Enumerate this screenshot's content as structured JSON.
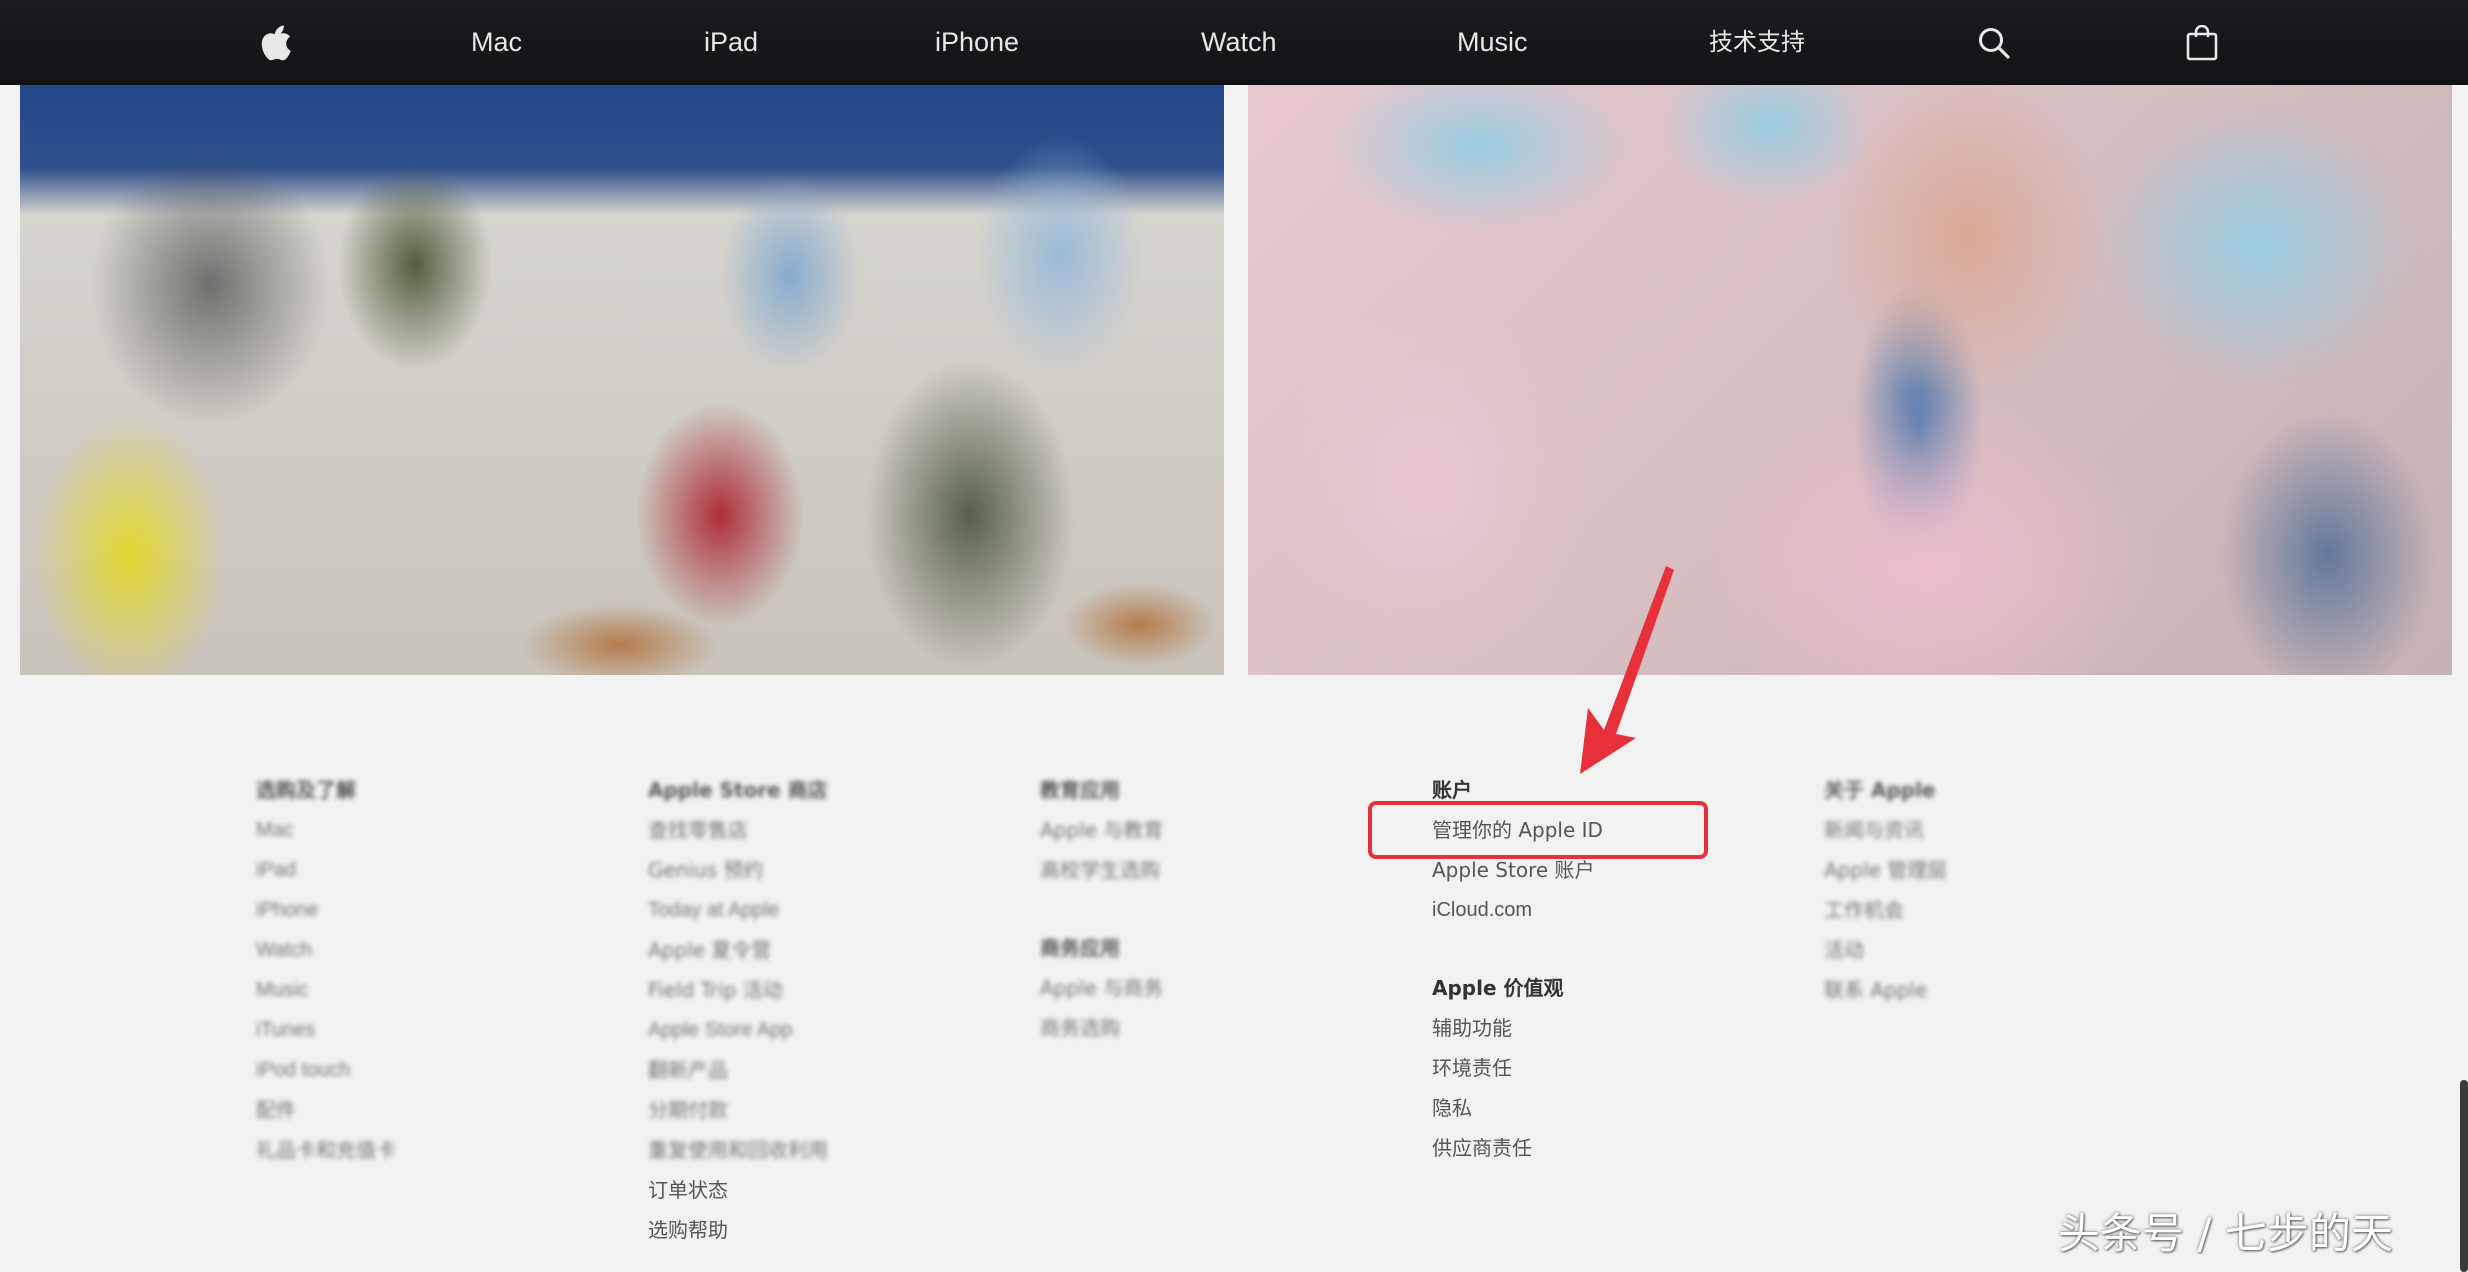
{
  "nav": {
    "items": [
      {
        "label": "Mac"
      },
      {
        "label": "iPad"
      },
      {
        "label": "iPhone"
      },
      {
        "label": "Watch"
      },
      {
        "label": "Music"
      },
      {
        "label": "技术支持"
      }
    ],
    "icons": [
      "apple-logo-icon",
      "search-icon",
      "shopping-bag-icon"
    ],
    "background_color": "#111214"
  },
  "footer": {
    "columns": [
      {
        "heading": "选购及了解",
        "sections": [
          [
            "Mac",
            "iPad",
            "iPhone",
            "Watch",
            "Music",
            "iTunes",
            "iPod touch",
            "配件",
            "礼品卡和充值卡"
          ]
        ]
      },
      {
        "heading": "Apple Store 商店",
        "sections": [
          [
            "查找零售店",
            "Genius 预约",
            "Today at Apple",
            "Apple 夏令营",
            "Field Trip 活动",
            "Apple Store App",
            "翻新产品",
            "分期付款",
            "重复使用和回收利用",
            "订单状态",
            "选购帮助"
          ]
        ]
      },
      {
        "heading": "教育应用",
        "sections": [
          [
            "Apple 与教育",
            "高校学生选购"
          ],
          {
            "heading": "商务应用",
            "links": [
              "Apple 与商务",
              "商务选购"
            ]
          }
        ]
      },
      {
        "heading": "账户",
        "sections": [
          [
            "管理你的 Apple ID",
            "Apple Store 账户",
            "iCloud.com"
          ],
          {
            "heading": "Apple 价值观",
            "links": [
              "辅助功能",
              "环境责任",
              "隐私",
              "供应商责任"
            ]
          }
        ]
      },
      {
        "heading": "关于 Apple",
        "sections": [
          [
            "新闻与资讯",
            "Apple 管理层",
            "工作机会",
            "活动",
            "联系 Apple"
          ]
        ]
      }
    ]
  },
  "annotation": {
    "color": "#e8303a"
  },
  "watermark": "头条号 / 七步的天"
}
